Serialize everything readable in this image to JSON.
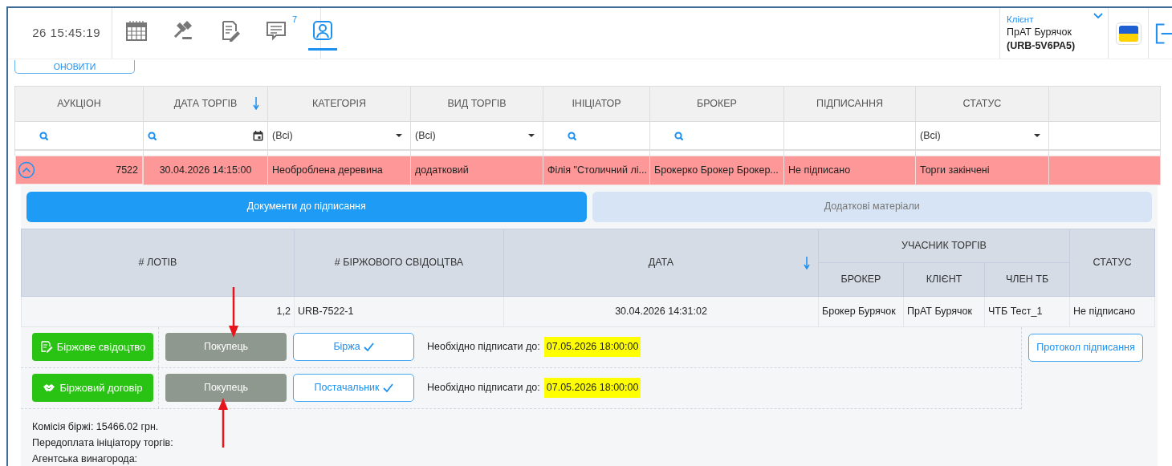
{
  "header": {
    "clock": "26 15:45:19",
    "nav": [
      {
        "kind": "calendar",
        "selected": false
      },
      {
        "kind": "gavel",
        "selected": false
      },
      {
        "kind": "contract",
        "selected": false
      },
      {
        "kind": "messages",
        "selected": false,
        "badge": "7"
      },
      {
        "kind": "profile",
        "selected": true
      }
    ],
    "account": {
      "role": "Клієнт",
      "name": "ПрАТ Бурячок",
      "code": "(URB-5V6PA5)"
    }
  },
  "refresh_button": "ОНОВИТИ",
  "auctions_table": {
    "columns": [
      {
        "label": "АУКЦІОН",
        "sorted": false
      },
      {
        "label": "ДАТА ТОРГІВ",
        "sorted": true
      },
      {
        "label": "КАТЕГОРІЯ",
        "sorted": false
      },
      {
        "label": "ВИД ТОРГІВ",
        "sorted": false
      },
      {
        "label": "ІНІЦІАТОР",
        "sorted": false
      },
      {
        "label": "БРОКЕР",
        "sorted": false
      },
      {
        "label": "ПІДПИСАННЯ",
        "sorted": false
      },
      {
        "label": "СТАТУС",
        "sorted": false
      },
      {
        "sorted": false
      }
    ],
    "filters": [
      {
        "kind": "search"
      },
      {
        "kind": "date"
      },
      {
        "kind": "select",
        "value": "(Всі)"
      },
      {
        "kind": "select",
        "value": "(Всі)"
      },
      {
        "kind": "search"
      },
      {
        "kind": "search"
      },
      {
        "kind": "none"
      },
      {
        "kind": "select",
        "value": "(Всі)"
      },
      {
        "kind": "none"
      }
    ],
    "rows": [
      {
        "expanded": true,
        "highlighted": true,
        "cells": [
          "7522",
          "30.04.2026 14:15:00",
          "Необроблена деревина",
          "додатковий",
          "Філія \"Столичний лі...",
          "Брокерко Брокер Брокер...",
          "Не підписано",
          "Торги закінчені",
          ""
        ]
      }
    ]
  },
  "detail": {
    "tabs": [
      {
        "label": "Документи до підписання",
        "selected": true
      },
      {
        "label": "Додаткові матеріали",
        "selected": false
      }
    ],
    "documents_table": {
      "columns": [
        {
          "label": "# ЛОТІВ",
          "sorted": false
        },
        {
          "label": "# БІРЖОВОГО СВІДОЦТВА",
          "sorted": false
        },
        {
          "label": "ДАТА",
          "sorted": true
        },
        {
          "label": "УЧАСНИК ТОРГІВ",
          "sorted": false,
          "colspan": 3,
          "children": [
            {
              "label": "БРОКЕР"
            },
            {
              "label": "КЛІЄНТ"
            },
            {
              "label": "ЧЛЕН ТБ"
            }
          ]
        },
        {
          "label": "СТАТУС",
          "sorted": false
        }
      ],
      "rows": [
        {
          "cells": [
            "1,2",
            "URB-7522-1",
            "30.04.2026 14:31:02",
            "Брокер Бурячок",
            "ПрАТ Бурячок",
            "ЧТБ Тест_1",
            "Не підписано"
          ]
        }
      ]
    },
    "documents": [
      {
        "kind": "certificate",
        "label": "Біржове свідоцтво",
        "party": {
          "label": "Покупець",
          "disabled": true
        },
        "signer": {
          "label": "Біржа",
          "signed": true
        },
        "deadline_label": "Необхідно підписати до:",
        "deadline": "07.05.2026 18:00:00"
      },
      {
        "kind": "contract",
        "label": "Біржовий договір",
        "party": {
          "label": "Покупець",
          "disabled": true
        },
        "signer": {
          "label": "Постачальник",
          "signed": true
        },
        "deadline_label": "Необхідно підписати до:",
        "deadline": "07.05.2026 18:00:00"
      }
    ],
    "protocol_button": "Протокол підписання",
    "notes": [
      "Комісія біржі: 15466.02 грн.",
      "Передоплата ініціатору торгів:",
      "Агентська винагорода:"
    ]
  }
}
